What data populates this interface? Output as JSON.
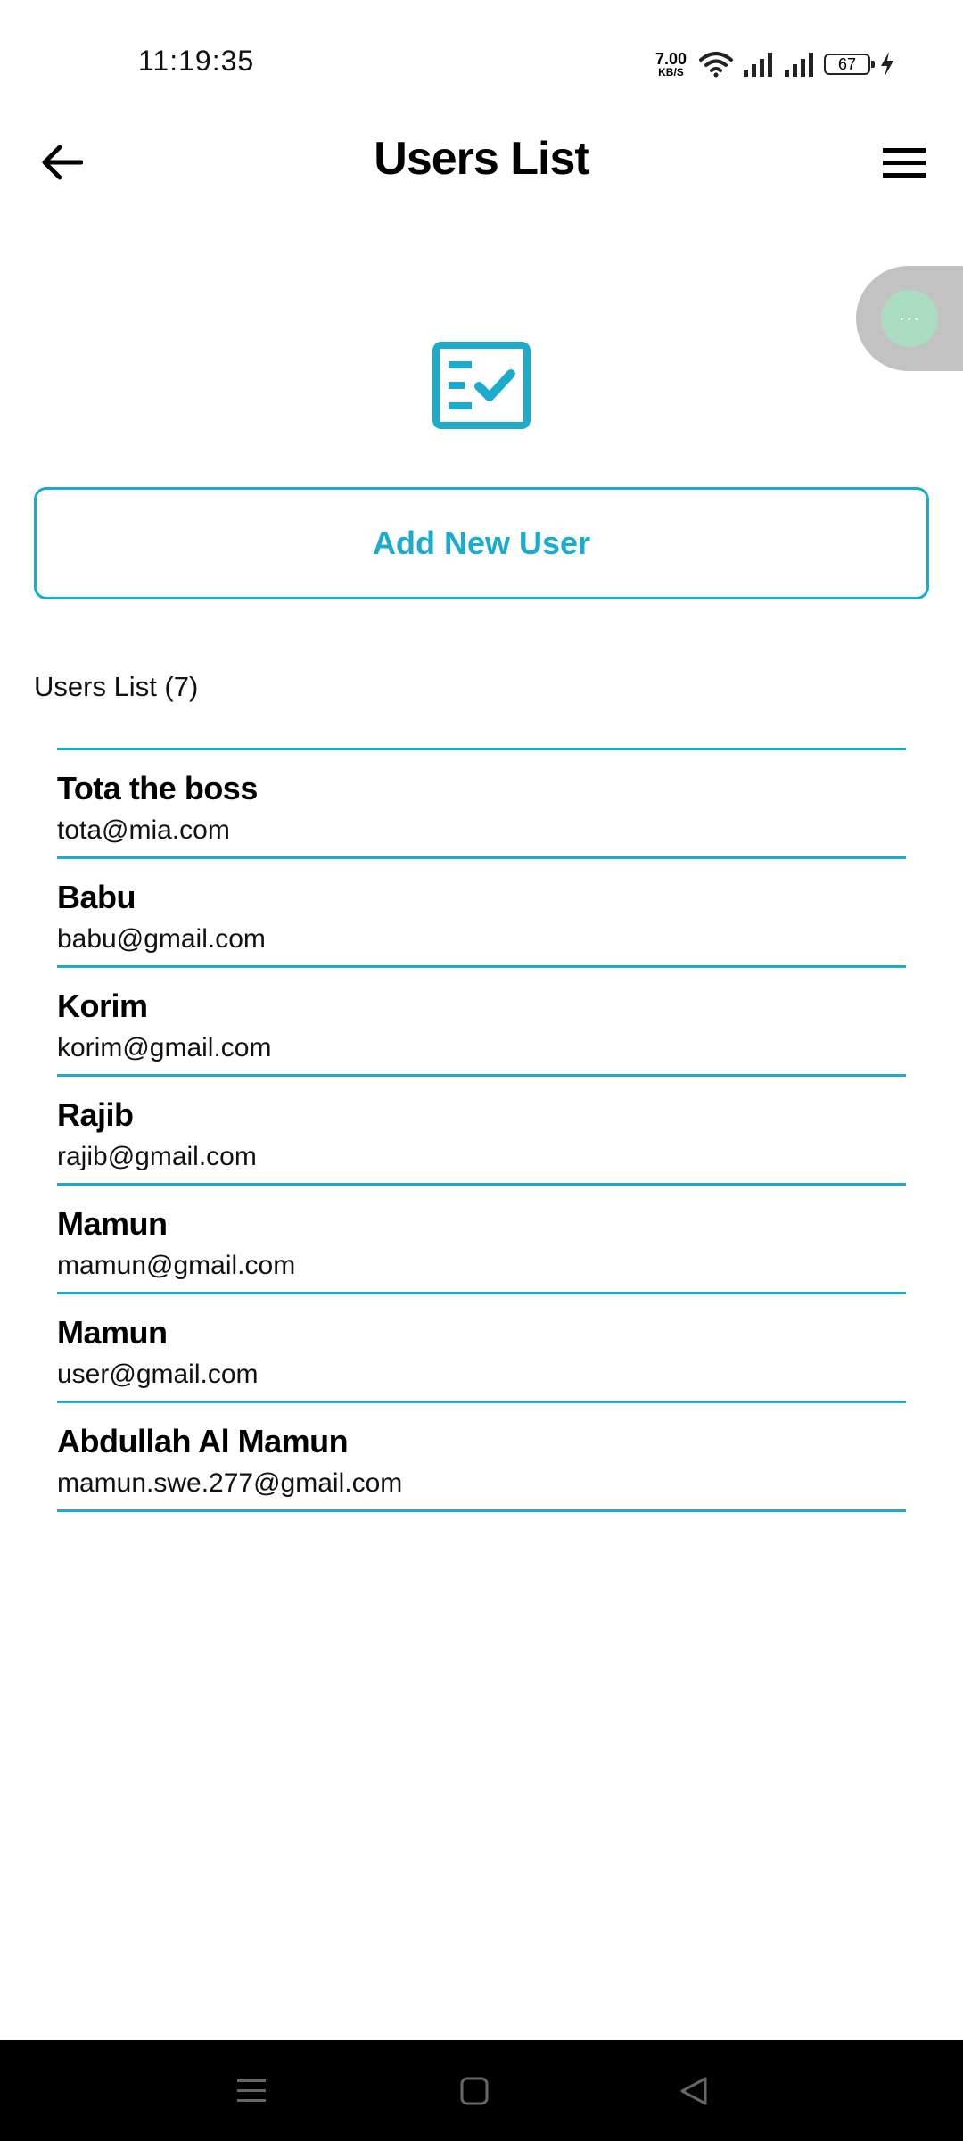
{
  "status_bar": {
    "time": "11:19:35",
    "net_speed_value": "7.00",
    "net_speed_unit": "KB/S",
    "battery": "67",
    "icons": [
      "wifi-icon",
      "signal-icon",
      "signal-icon",
      "battery-icon",
      "charging-icon"
    ]
  },
  "toolbar": {
    "title": "Users List",
    "back_icon": "back-arrow-icon",
    "menu_icon": "hamburger-menu-icon"
  },
  "floating_button": {
    "label": "···",
    "icon": "more-icon"
  },
  "header_icon": "checklist-icon",
  "accent_color": "#1aabcd",
  "add_user_button": {
    "label": "Add New User"
  },
  "users_section": {
    "heading": "Users List (7)"
  },
  "users": [
    {
      "name": "Tota the boss",
      "email": "tota@mia.com"
    },
    {
      "name": "Babu",
      "email": "babu@gmail.com"
    },
    {
      "name": "Korim",
      "email": "korim@gmail.com"
    },
    {
      "name": "Rajib",
      "email": "rajib@gmail.com"
    },
    {
      "name": "Mamun",
      "email": "mamun@gmail.com"
    },
    {
      "name": "Mamun",
      "email": "user@gmail.com"
    },
    {
      "name": "Abdullah Al Mamun",
      "email": "mamun.swe.277@gmail.com"
    }
  ],
  "nav_bar": {
    "icons": [
      "recents-icon",
      "home-icon",
      "back-triangle-icon"
    ]
  }
}
